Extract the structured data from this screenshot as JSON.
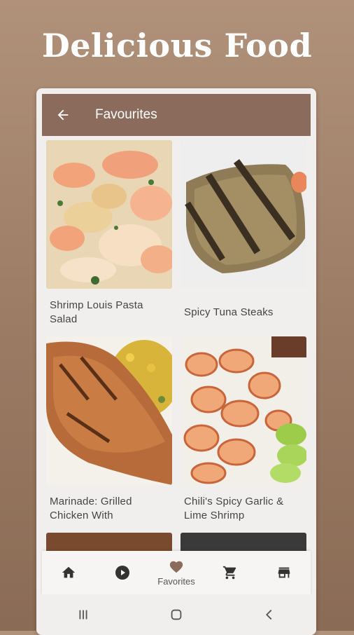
{
  "headline": "Delicious Food",
  "app_bar": {
    "title": "Favourites"
  },
  "recipes": [
    {
      "title": "Shrimp Louis Pasta Salad"
    },
    {
      "title": "Spicy Tuna Steaks"
    },
    {
      "title": "Marinade: Grilled Chicken With"
    },
    {
      "title": "Chili's Spicy Garlic & Lime Shrimp"
    }
  ],
  "bottom_nav": {
    "items": [
      {
        "icon": "home-icon",
        "label": ""
      },
      {
        "icon": "play-circle-icon",
        "label": ""
      },
      {
        "icon": "heart-icon",
        "label": "Favorites"
      },
      {
        "icon": "cart-icon",
        "label": ""
      },
      {
        "icon": "store-icon",
        "label": ""
      }
    ]
  },
  "colors": {
    "accent": "#8b6c5c",
    "background_top": "#b0917a",
    "background_bottom": "#8a6b55"
  }
}
